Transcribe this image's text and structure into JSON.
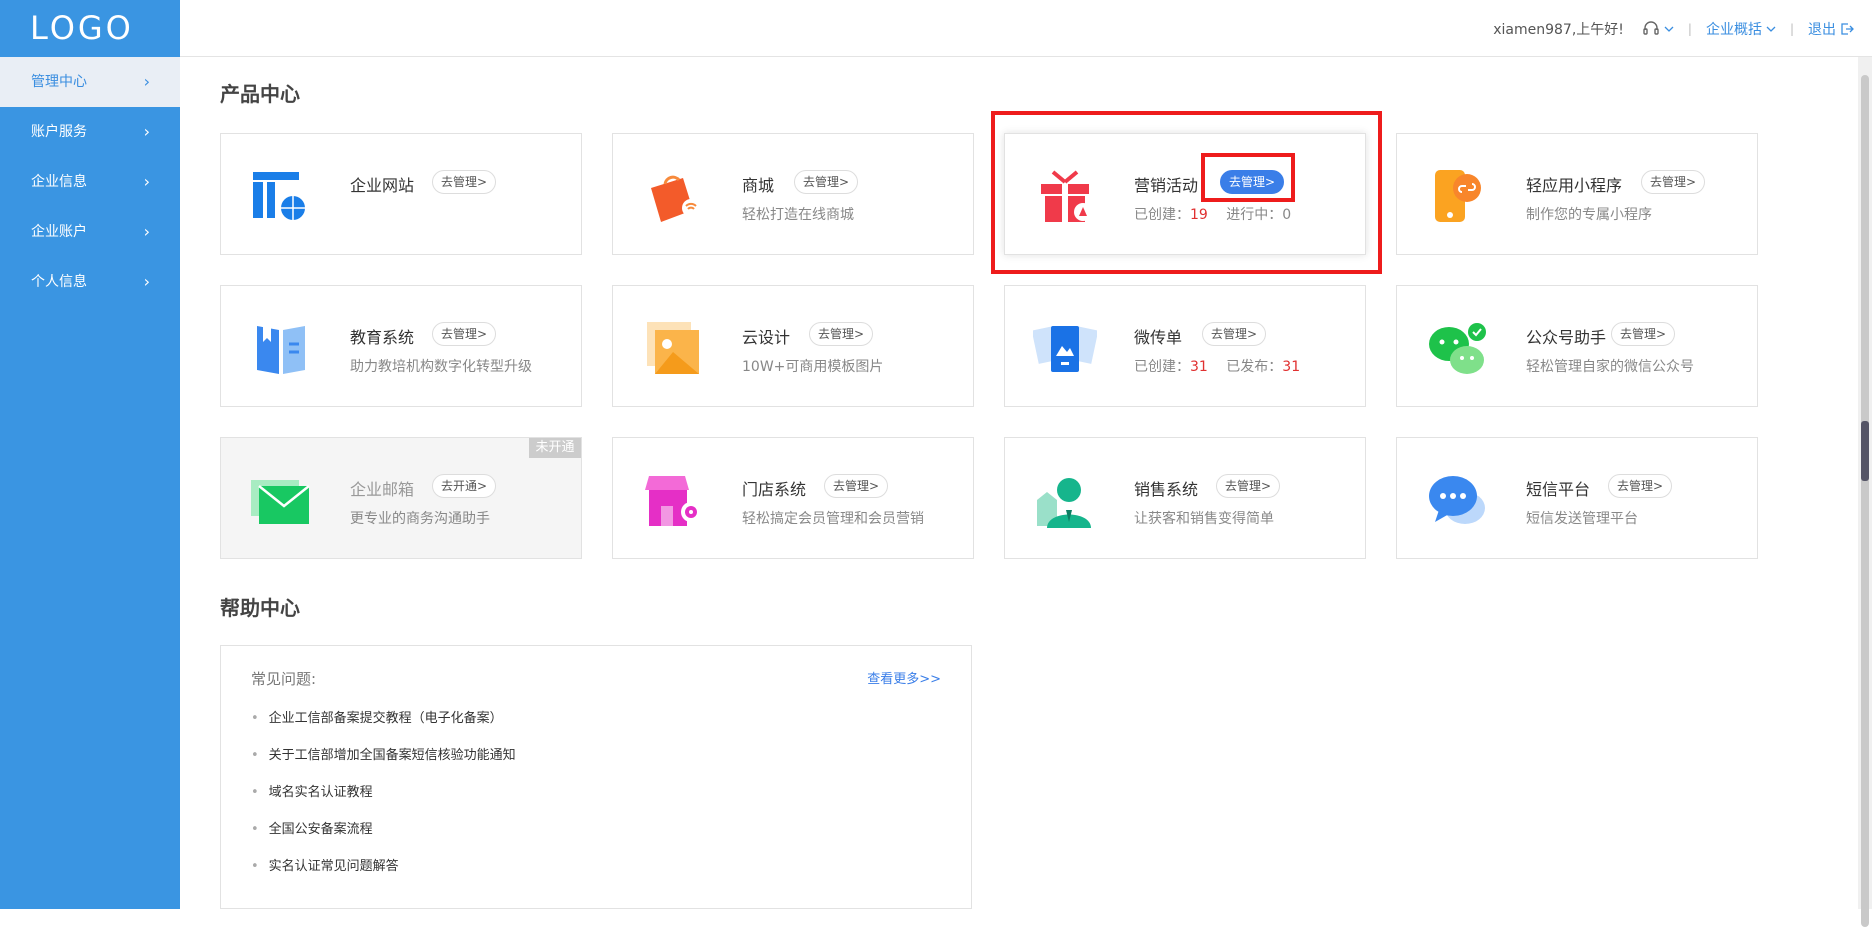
{
  "sidebar": {
    "logo": "LOGO",
    "items": [
      {
        "label": "管理中心"
      },
      {
        "label": "账户服务"
      },
      {
        "label": "企业信息"
      },
      {
        "label": "企业账户"
      },
      {
        "label": "个人信息"
      }
    ],
    "chevron": "›"
  },
  "header": {
    "greeting": "xiamen987,上午好!",
    "overview": "企业概括",
    "logout": "退出",
    "icons": [
      "headset-icon",
      "chevron-down-icon",
      "logout-icon"
    ]
  },
  "products": {
    "title": "产品中心",
    "cards": [
      {
        "title": "企业网站",
        "button": "去管理>",
        "desc": ""
      },
      {
        "title": "商城",
        "button": "去管理>",
        "desc": "轻松打造在线商城"
      },
      {
        "title": "营销活动",
        "button": "去管理>",
        "created_label": "已创建：",
        "created": "19",
        "running_label": "进行中：",
        "running": "0"
      },
      {
        "title": "轻应用小程序",
        "button": "去管理>",
        "desc": "制作您的专属小程序"
      },
      {
        "title": "教育系统",
        "button": "去管理>",
        "desc": "助力教培机构数字化转型升级"
      },
      {
        "title": "云设计",
        "button": "去管理>",
        "desc": "10W+可商用模板图片"
      },
      {
        "title": "微传单",
        "button": "去管理>",
        "created_label": "已创建：",
        "created": "31",
        "published_label": "已发布：",
        "published": "31"
      },
      {
        "title": "公众号助手",
        "button": "去管理>",
        "desc": "轻松管理自家的微信公众号"
      },
      {
        "title": "企业邮箱",
        "button": "去开通>",
        "desc": "更专业的商务沟通助手",
        "badge": "未开通"
      },
      {
        "title": "门店系统",
        "button": "去管理>",
        "desc": "轻松搞定会员管理和会员营销"
      },
      {
        "title": "销售系统",
        "button": "去管理>",
        "desc": "让获客和销售变得简单"
      },
      {
        "title": "短信平台",
        "button": "去管理>",
        "desc": "短信发送管理平台"
      }
    ]
  },
  "help": {
    "title": "帮助中心",
    "faq_label": "常见问题:",
    "more": "查看更多>>",
    "items": [
      "企业工信部备案提交教程（电子化备案）",
      "关于工信部增加全国备案短信核验功能通知",
      "域名实名认证教程",
      "全国公安备案流程",
      "实名认证常见问题解答"
    ]
  },
  "colors": {
    "sidebar": "#3a95e2",
    "accent": "#3a7ee8",
    "highlight": "#ee1c1c",
    "count": "#e03030"
  }
}
